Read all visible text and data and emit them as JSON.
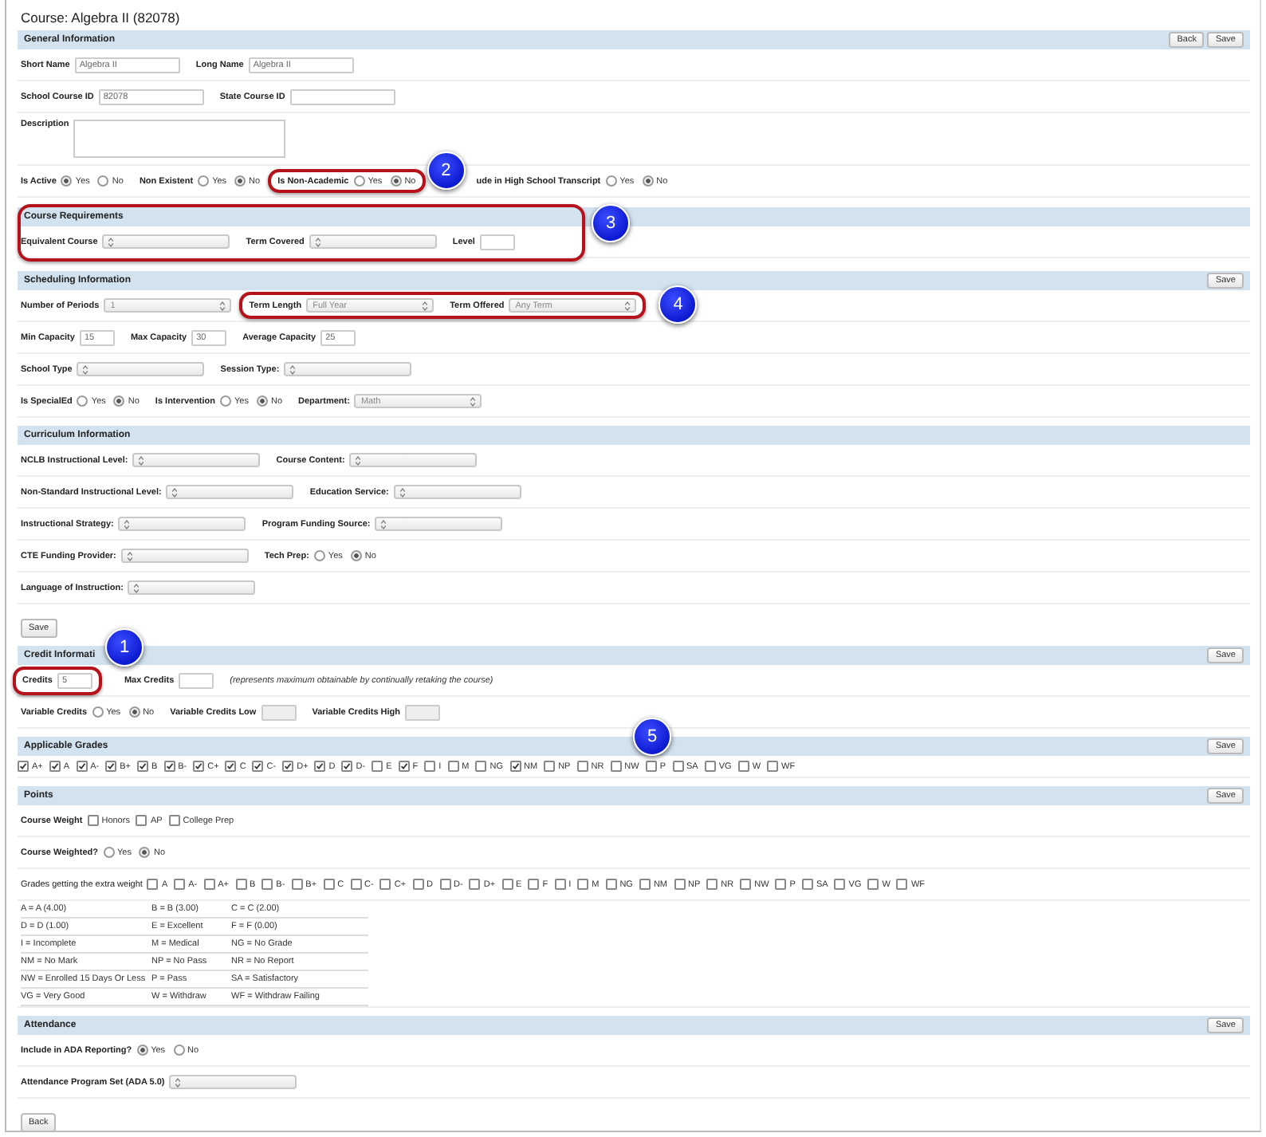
{
  "title": "Course: Algebra II (82078)",
  "sections": [
    {
      "title": "General Information",
      "buttons": [
        "Back",
        "Save"
      ],
      "rows": [
        {
          "fields": [
            {
              "kind": "text",
              "label": "Short Name",
              "value": "Algebra II"
            },
            {
              "kind": "text",
              "label": "Long Name",
              "value": "Algebra II"
            }
          ]
        },
        {
          "fields": [
            {
              "kind": "text",
              "label": "School Course ID",
              "value": "82078"
            },
            {
              "kind": "text",
              "label": "State Course ID"
            }
          ]
        },
        {
          "fields": [
            {
              "kind": "textarea",
              "label": "Description"
            }
          ]
        },
        {
          "fields": [
            {
              "kind": "radio",
              "label": "Is Active",
              "options": [
                {
                  "label": "Yes",
                  "selected": true
                },
                {
                  "label": "No",
                  "selected": false
                }
              ]
            },
            {
              "kind": "radio",
              "label": "Non Existent",
              "options": [
                {
                  "label": "Yes",
                  "selected": false
                },
                {
                  "label": "No",
                  "selected": true
                }
              ]
            },
            {
              "kind": "group",
              "callout": "2",
              "fields": [
                {
                  "kind": "radio",
                  "label": "Is Non-Academic",
                  "options": [
                    {
                      "label": "Yes",
                      "selected": false
                    },
                    {
                      "label": "No",
                      "selected": true
                    }
                  ]
                }
              ]
            },
            {
              "kind": "radio",
              "label": "ude in High School Transcript",
              "options": [
                {
                  "label": "Yes",
                  "selected": false
                },
                {
                  "label": "No",
                  "selected": true
                }
              ]
            }
          ]
        }
      ]
    },
    {
      "title": "Course Requirements",
      "callout": "3",
      "outlined": true,
      "rows": [
        {
          "fields": [
            {
              "kind": "select",
              "label": "Equivalent Course"
            },
            {
              "kind": "select",
              "label": "Term Covered"
            },
            {
              "kind": "short",
              "label": "Level"
            }
          ]
        }
      ]
    },
    {
      "title": "Scheduling Information",
      "buttons": [
        "Save"
      ],
      "rows": [
        {
          "fields": [
            {
              "kind": "select",
              "label": "Number of Periods",
              "value": "1"
            },
            {
              "kind": "group",
              "callout": "4",
              "fields": [
                {
                  "kind": "select",
                  "label": "Term Length",
                  "value": "Full Year"
                },
                {
                  "kind": "select",
                  "label": "Term Offered",
                  "value": "Any Term"
                }
              ]
            }
          ]
        },
        {
          "fields": [
            {
              "kind": "short",
              "label": "Min Capacity",
              "value": "15"
            },
            {
              "kind": "short",
              "label": "Max Capacity",
              "value": "30"
            },
            {
              "kind": "short",
              "label": "Average Capacity",
              "value": "25"
            }
          ]
        },
        {
          "fields": [
            {
              "kind": "select",
              "label": "School Type"
            },
            {
              "kind": "select",
              "label": "Session Type:"
            }
          ]
        },
        {
          "fields": [
            {
              "kind": "radio",
              "label": "Is SpecialEd",
              "options": [
                {
                  "label": "Yes",
                  "selected": false
                },
                {
                  "label": "No",
                  "selected": true
                }
              ]
            },
            {
              "kind": "radio",
              "label": "Is Intervention",
              "options": [
                {
                  "label": "Yes",
                  "selected": false
                },
                {
                  "label": "No",
                  "selected": true
                }
              ]
            },
            {
              "kind": "select",
              "label": "Department:",
              "value": "Math"
            }
          ]
        }
      ]
    },
    {
      "title": "Curriculum Information",
      "footer_buttons": [
        "Save"
      ],
      "rows": [
        {
          "fields": [
            {
              "kind": "select",
              "label": "NCLB Instructional Level:"
            },
            {
              "kind": "select",
              "label": "Course Content:"
            }
          ]
        },
        {
          "fields": [
            {
              "kind": "select",
              "label": "Non-Standard Instructional Level:"
            },
            {
              "kind": "select",
              "label": "Education Service:"
            }
          ]
        },
        {
          "fields": [
            {
              "kind": "select",
              "label": "Instructional Strategy:"
            },
            {
              "kind": "select",
              "label": "Program Funding Source:"
            }
          ]
        },
        {
          "fields": [
            {
              "kind": "select",
              "label": "CTE Funding Provider:"
            },
            {
              "kind": "radio",
              "label": "Tech Prep:",
              "options": [
                {
                  "label": "Yes",
                  "selected": false
                },
                {
                  "label": "No",
                  "selected": true
                }
              ]
            }
          ]
        },
        {
          "fields": [
            {
              "kind": "select",
              "label": "Language of Instruction:"
            }
          ]
        }
      ]
    },
    {
      "title": "Credit Informati",
      "buttons": [
        "Save"
      ],
      "rows": [
        {
          "fields": [
            {
              "kind": "group",
              "callout": "1",
              "fields": [
                {
                  "kind": "short",
                  "label": "Credits",
                  "value": "5"
                }
              ]
            },
            {
              "kind": "short",
              "label": "Max Credits"
            },
            {
              "kind": "note",
              "text": "(represents maximum obtainable by continually retaking the course)"
            }
          ]
        },
        {
          "fields": [
            {
              "kind": "radio",
              "label": "Variable Credits",
              "options": [
                {
                  "label": "Yes",
                  "selected": false
                },
                {
                  "label": "No",
                  "selected": true
                }
              ]
            },
            {
              "kind": "short",
              "label": "Variable Credits Low",
              "disabled": true
            },
            {
              "kind": "short",
              "label": "Variable Credits High",
              "disabled": true
            }
          ]
        }
      ]
    },
    {
      "title": "Applicable Grades",
      "buttons": [
        "Save"
      ],
      "callout": "5",
      "outlined": false,
      "rows": [
        {
          "fields": [
            {
              "kind": "checks",
              "options": [
                {
                  "label": "A+",
                  "checked": true
                },
                {
                  "label": "A",
                  "checked": true
                },
                {
                  "label": "A-",
                  "checked": true
                },
                {
                  "label": "B+",
                  "checked": true
                },
                {
                  "label": "B",
                  "checked": true
                },
                {
                  "label": "B-",
                  "checked": true
                },
                {
                  "label": "C+",
                  "checked": true
                },
                {
                  "label": "C",
                  "checked": true
                },
                {
                  "label": "C-",
                  "checked": true
                },
                {
                  "label": "D+",
                  "checked": true
                },
                {
                  "label": "D",
                  "checked": true
                },
                {
                  "label": "D-",
                  "checked": true
                },
                {
                  "label": "E",
                  "checked": false
                },
                {
                  "label": "F",
                  "checked": true
                },
                {
                  "label": "I",
                  "checked": false
                },
                {
                  "label": "M",
                  "checked": false
                },
                {
                  "label": "NG",
                  "checked": false
                },
                {
                  "label": "NM",
                  "checked": true
                },
                {
                  "label": "NP",
                  "checked": false
                },
                {
                  "label": "NR",
                  "checked": false
                },
                {
                  "label": "NW",
                  "checked": false
                },
                {
                  "label": "P",
                  "checked": false
                },
                {
                  "label": "SA",
                  "checked": false
                },
                {
                  "label": "VG",
                  "checked": false
                },
                {
                  "label": "W",
                  "checked": false
                },
                {
                  "label": "WF",
                  "checked": false
                }
              ]
            }
          ]
        }
      ]
    },
    {
      "title": "Points",
      "buttons": [
        "Save"
      ],
      "rows": [
        {
          "fields": [
            {
              "kind": "checks",
              "label": "Course Weight",
              "options": [
                {
                  "label": "Honors",
                  "checked": false
                },
                {
                  "label": "AP",
                  "checked": false
                },
                {
                  "label": "College Prep",
                  "checked": false
                }
              ]
            }
          ]
        },
        {
          "fields": [
            {
              "kind": "radio",
              "label": "Course Weighted?",
              "options": [
                {
                  "label": "Yes",
                  "selected": false
                },
                {
                  "label": "No",
                  "selected": true
                }
              ]
            }
          ]
        },
        {
          "fields": [
            {
              "kind": "checks",
              "label": "Grades getting the extra weight",
              "plain": true,
              "options": [
                {
                  "label": "A",
                  "checked": false
                },
                {
                  "label": "A-",
                  "checked": false
                },
                {
                  "label": "A+",
                  "checked": false
                },
                {
                  "label": "B",
                  "checked": false
                },
                {
                  "label": "B-",
                  "checked": false
                },
                {
                  "label": "B+",
                  "checked": false
                },
                {
                  "label": "C",
                  "checked": false
                },
                {
                  "label": "C-",
                  "checked": false
                },
                {
                  "label": "C+",
                  "checked": false
                },
                {
                  "label": "D",
                  "checked": false
                },
                {
                  "label": "D-",
                  "checked": false
                },
                {
                  "label": "D+",
                  "checked": false
                },
                {
                  "label": "E",
                  "checked": false
                },
                {
                  "label": "F",
                  "checked": false
                },
                {
                  "label": "I",
                  "checked": false
                },
                {
                  "label": "M",
                  "checked": false
                },
                {
                  "label": "NG",
                  "checked": false
                },
                {
                  "label": "NM",
                  "checked": false
                },
                {
                  "label": "NP",
                  "checked": false
                },
                {
                  "label": "NR",
                  "checked": false
                },
                {
                  "label": "NW",
                  "checked": false
                },
                {
                  "label": "P",
                  "checked": false
                },
                {
                  "label": "SA",
                  "checked": false
                },
                {
                  "label": "VG",
                  "checked": false
                },
                {
                  "label": "W",
                  "checked": false
                },
                {
                  "label": "WF",
                  "checked": false
                }
              ]
            }
          ]
        },
        {
          "fields": [
            {
              "kind": "legend",
              "rows": [
                [
                  "A = A (4.00)",
                  "B = B (3.00)",
                  "C = C (2.00)"
                ],
                [
                  "D = D (1.00)",
                  "E = Excellent",
                  "F = F (0.00)"
                ],
                [
                  "I = Incomplete",
                  "M = Medical",
                  "NG = No Grade"
                ],
                [
                  "NM = No Mark",
                  "NP = No Pass",
                  "NR = No Report"
                ],
                [
                  "NW = Enrolled 15 Days Or Less",
                  "P = Pass",
                  "SA = Satisfactory"
                ],
                [
                  "VG = Very Good",
                  "W = Withdraw",
                  "WF = Withdraw Failing"
                ]
              ]
            }
          ]
        }
      ]
    },
    {
      "title": "Attendance",
      "buttons": [
        "Save"
      ],
      "footer_buttons": [
        "Back"
      ],
      "rows": [
        {
          "fields": [
            {
              "kind": "radio",
              "label": "Include in ADA Reporting?",
              "options": [
                {
                  "label": "Yes",
                  "selected": true
                },
                {
                  "label": "No",
                  "selected": false
                }
              ]
            }
          ]
        },
        {
          "fields": [
            {
              "kind": "select",
              "label": "Attendance Program Set (ADA 5.0)"
            }
          ]
        }
      ]
    }
  ]
}
